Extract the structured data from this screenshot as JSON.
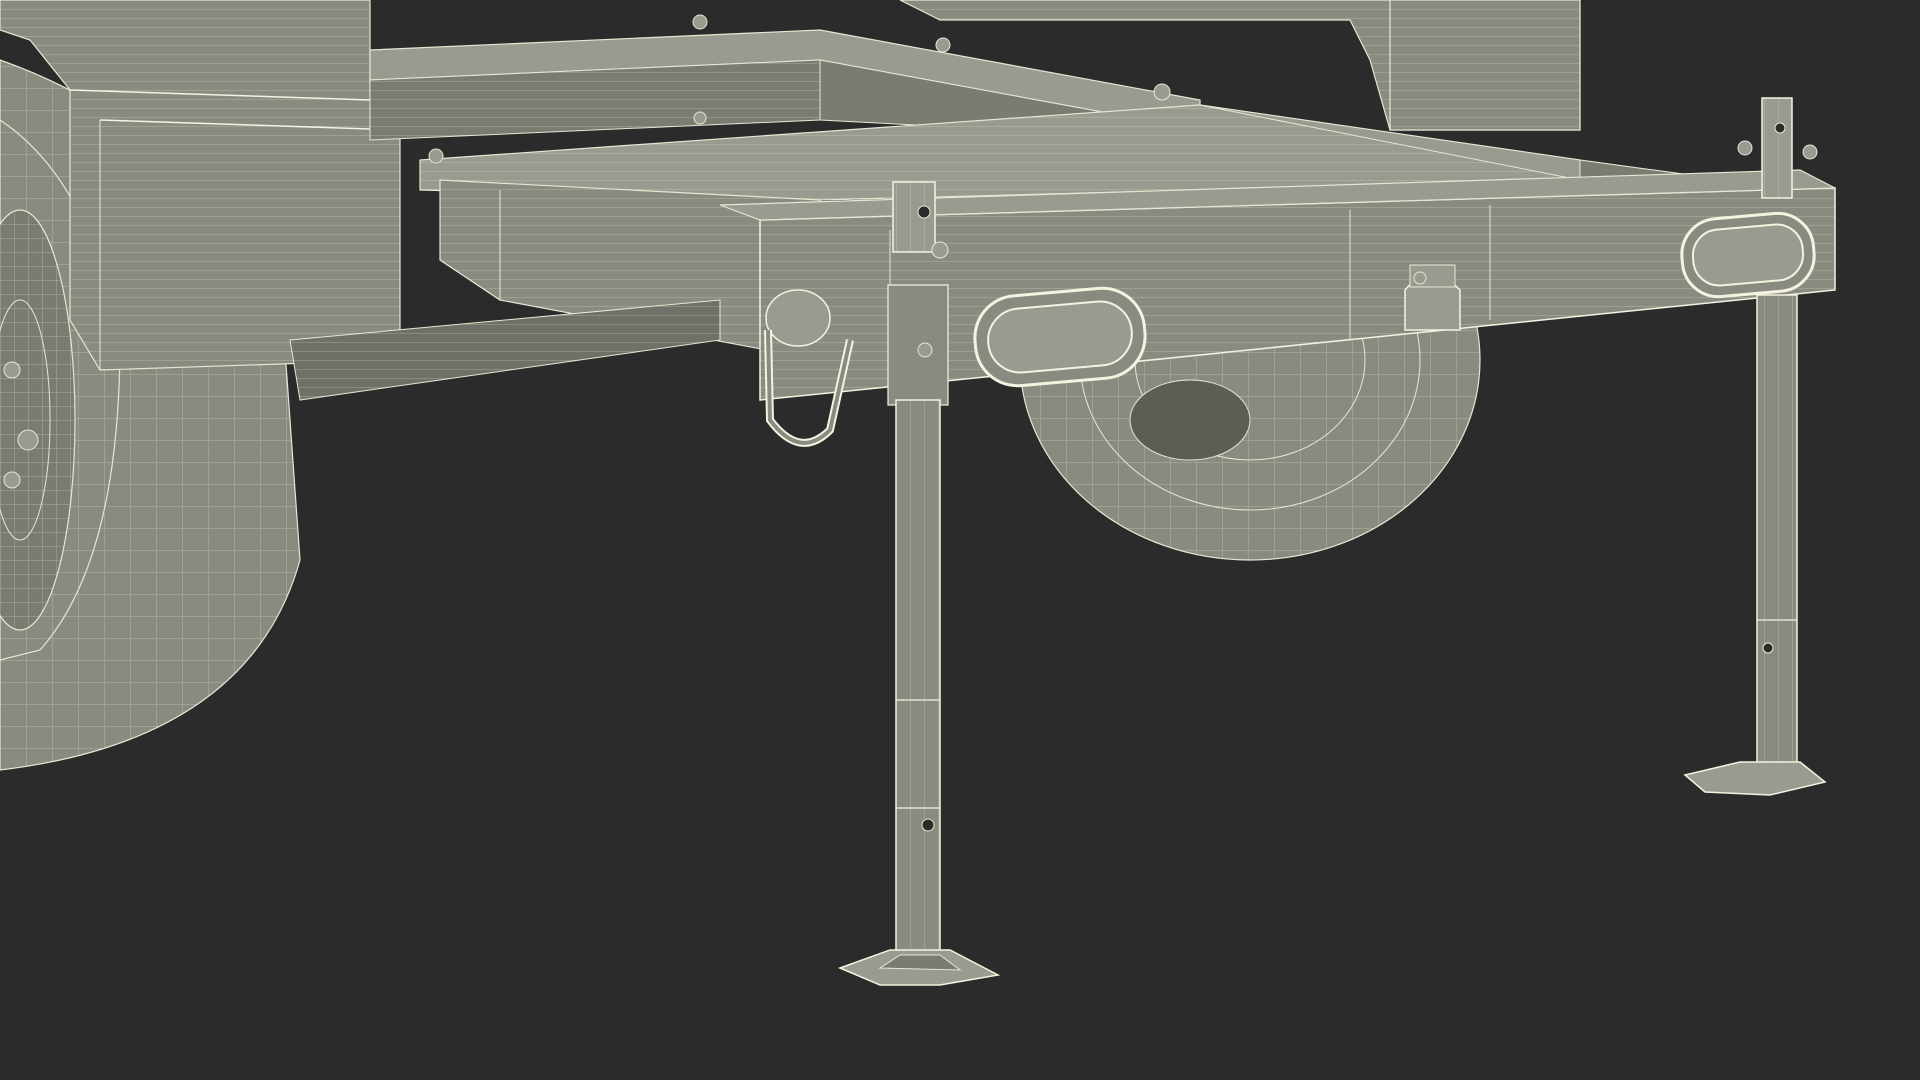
{
  "scene": {
    "background": "#2b2b2b",
    "model_fill": "#8a8b80",
    "model_fill_dark": "#6f7067",
    "model_fill_light": "#9a9b90",
    "wire_color": "#e8e6d2",
    "edge_color": "#f4f2e0"
  },
  "parts": [
    "left-wheel",
    "left-fender",
    "rear-wheel",
    "rear-fender",
    "frame-rails",
    "rear-crossbar",
    "left-stabilizer-leg",
    "right-stabilizer-leg",
    "tail-light-left",
    "tail-light-right",
    "tow-ring",
    "reflector",
    "bolts"
  ]
}
